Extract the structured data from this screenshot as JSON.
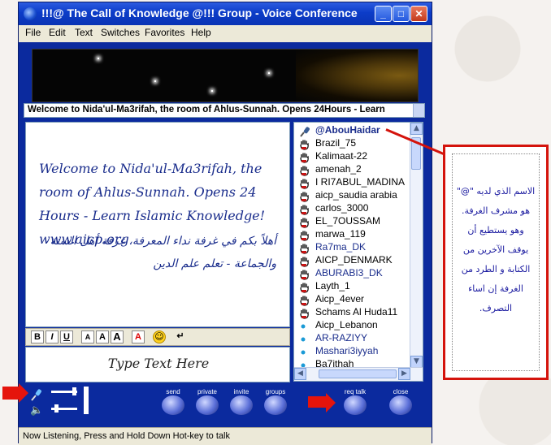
{
  "window": {
    "title": "!!!@ The Call of Knowledge @!!! Group - Voice Conference",
    "controls": {
      "minimize": "_",
      "maximize": "□",
      "close": "✕"
    }
  },
  "menu": [
    "File",
    "Edit",
    "Text",
    "Switches",
    "Favorites",
    "Help"
  ],
  "welcome_bar": "Welcome to Nida'ul-Ma3rifah, the room of Ahlus-Sunnah. Opens 24Hours - Learn",
  "chat": {
    "english": "Welcome to Nida'ul-Ma3rifah, the room of Ahlus-Sunnah. Opens 24 Hours - Learn Islamic Knowledge! www.aicp.org",
    "arabic": "أهلاً بكم في غرفة نداء المعرفة، غرفة أهل السنة والجماعة - تعلم علم الدين"
  },
  "format_toolbar": {
    "bold": "B",
    "italic": "I",
    "underline": "U",
    "size_small": "A",
    "size_medium": "A",
    "size_large": "A",
    "color": "A",
    "emoticon": "☺",
    "enter": "↵"
  },
  "input": {
    "placeholder": "Type Text Here"
  },
  "users": [
    {
      "name": "@AbouHaidar",
      "icon": "microphone-icon",
      "color": "#1a2d8c",
      "bold": true
    },
    {
      "name": "Brazil_75",
      "icon": "hand-icon",
      "color": "#000000"
    },
    {
      "name": "Kalimaat-22",
      "icon": "hand-icon",
      "color": "#000000"
    },
    {
      "name": "amenah_2",
      "icon": "hand-icon",
      "color": "#000000"
    },
    {
      "name": "I RI7ABUL_MADINA",
      "icon": "hand-icon",
      "color": "#000000"
    },
    {
      "name": "aicp_saudia arabia",
      "icon": "hand-icon",
      "color": "#000000"
    },
    {
      "name": "carlos_3000",
      "icon": "hand-icon",
      "color": "#000000"
    },
    {
      "name": "EL_7OUSSAM",
      "icon": "hand-icon",
      "color": "#000000"
    },
    {
      "name": "marwa_119",
      "icon": "hand-icon",
      "color": "#000000"
    },
    {
      "name": "Ra7ma_DK",
      "icon": "hand-icon",
      "color": "#1a2d8c"
    },
    {
      "name": "AICP_DENMARK",
      "icon": "hand-icon",
      "color": "#000000"
    },
    {
      "name": "ABURABI3_DK",
      "icon": "hand-icon",
      "color": "#1a2d8c"
    },
    {
      "name": "Layth_1",
      "icon": "hand-icon",
      "color": "#000000"
    },
    {
      "name": "Aicp_4ever",
      "icon": "hand-icon",
      "color": "#000000"
    },
    {
      "name": "Schams Al Huda11",
      "icon": "hand-icon",
      "color": "#000000"
    },
    {
      "name": "Aicp_Lebanon",
      "icon": "dot-icon",
      "color": "#000000"
    },
    {
      "name": "AR-RAZIYY",
      "icon": "dot-icon",
      "color": "#1a2d8c"
    },
    {
      "name": "Mashari3iyyah",
      "icon": "dot-icon",
      "color": "#1a2d8c"
    },
    {
      "name": "Ba7ithah",
      "icon": "dot-icon",
      "color": "#000000"
    }
  ],
  "toolbar": {
    "send": "send",
    "private": "private",
    "invite": "invite",
    "groups": "groups",
    "req_talk": "req talk",
    "close": "close"
  },
  "status": "Now Listening, Press and Hold Down Hot-key to talk",
  "annotation": {
    "text": "الاسم الذي لديه \"@\" هو مشرف الغرفة. وهو يستطيع أن يوقف الآخرين من الكتابة و الطرد من الغرفة إن اساء التصرف."
  }
}
